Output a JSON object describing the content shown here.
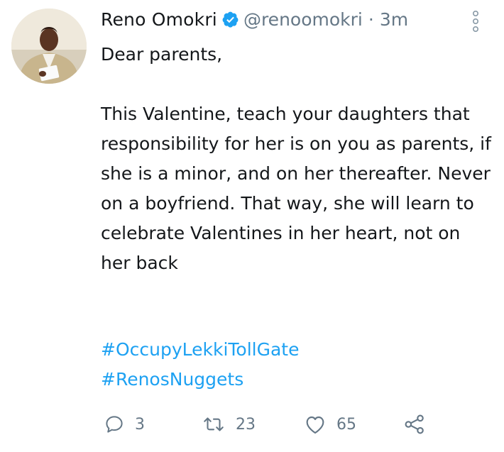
{
  "tweet": {
    "author_name": "Reno Omokri",
    "handle": "@renoomokri",
    "separator": "·",
    "time": "3m",
    "greeting": "Dear parents,",
    "body": "This Valentine, teach your daughters that responsibility for her is on you as parents, if she is a minor, and on her thereafter. Never on a boyfriend. That way, she will learn to celebrate Valentines in her heart, not on her back",
    "hashtags": [
      "#OccupyLekkiTollGate",
      "#RenosNuggets"
    ]
  },
  "actions": {
    "reply_count": "3",
    "retweet_count": "23",
    "like_count": "65"
  },
  "icons": {
    "verified": "verified-badge-icon",
    "more": "vertical-ellipsis-icon",
    "reply": "reply-icon",
    "retweet": "retweet-icon",
    "like": "heart-icon",
    "share": "share-icon"
  },
  "colors": {
    "text": "#14171a",
    "secondary": "#657786",
    "accent": "#1da1f2"
  }
}
